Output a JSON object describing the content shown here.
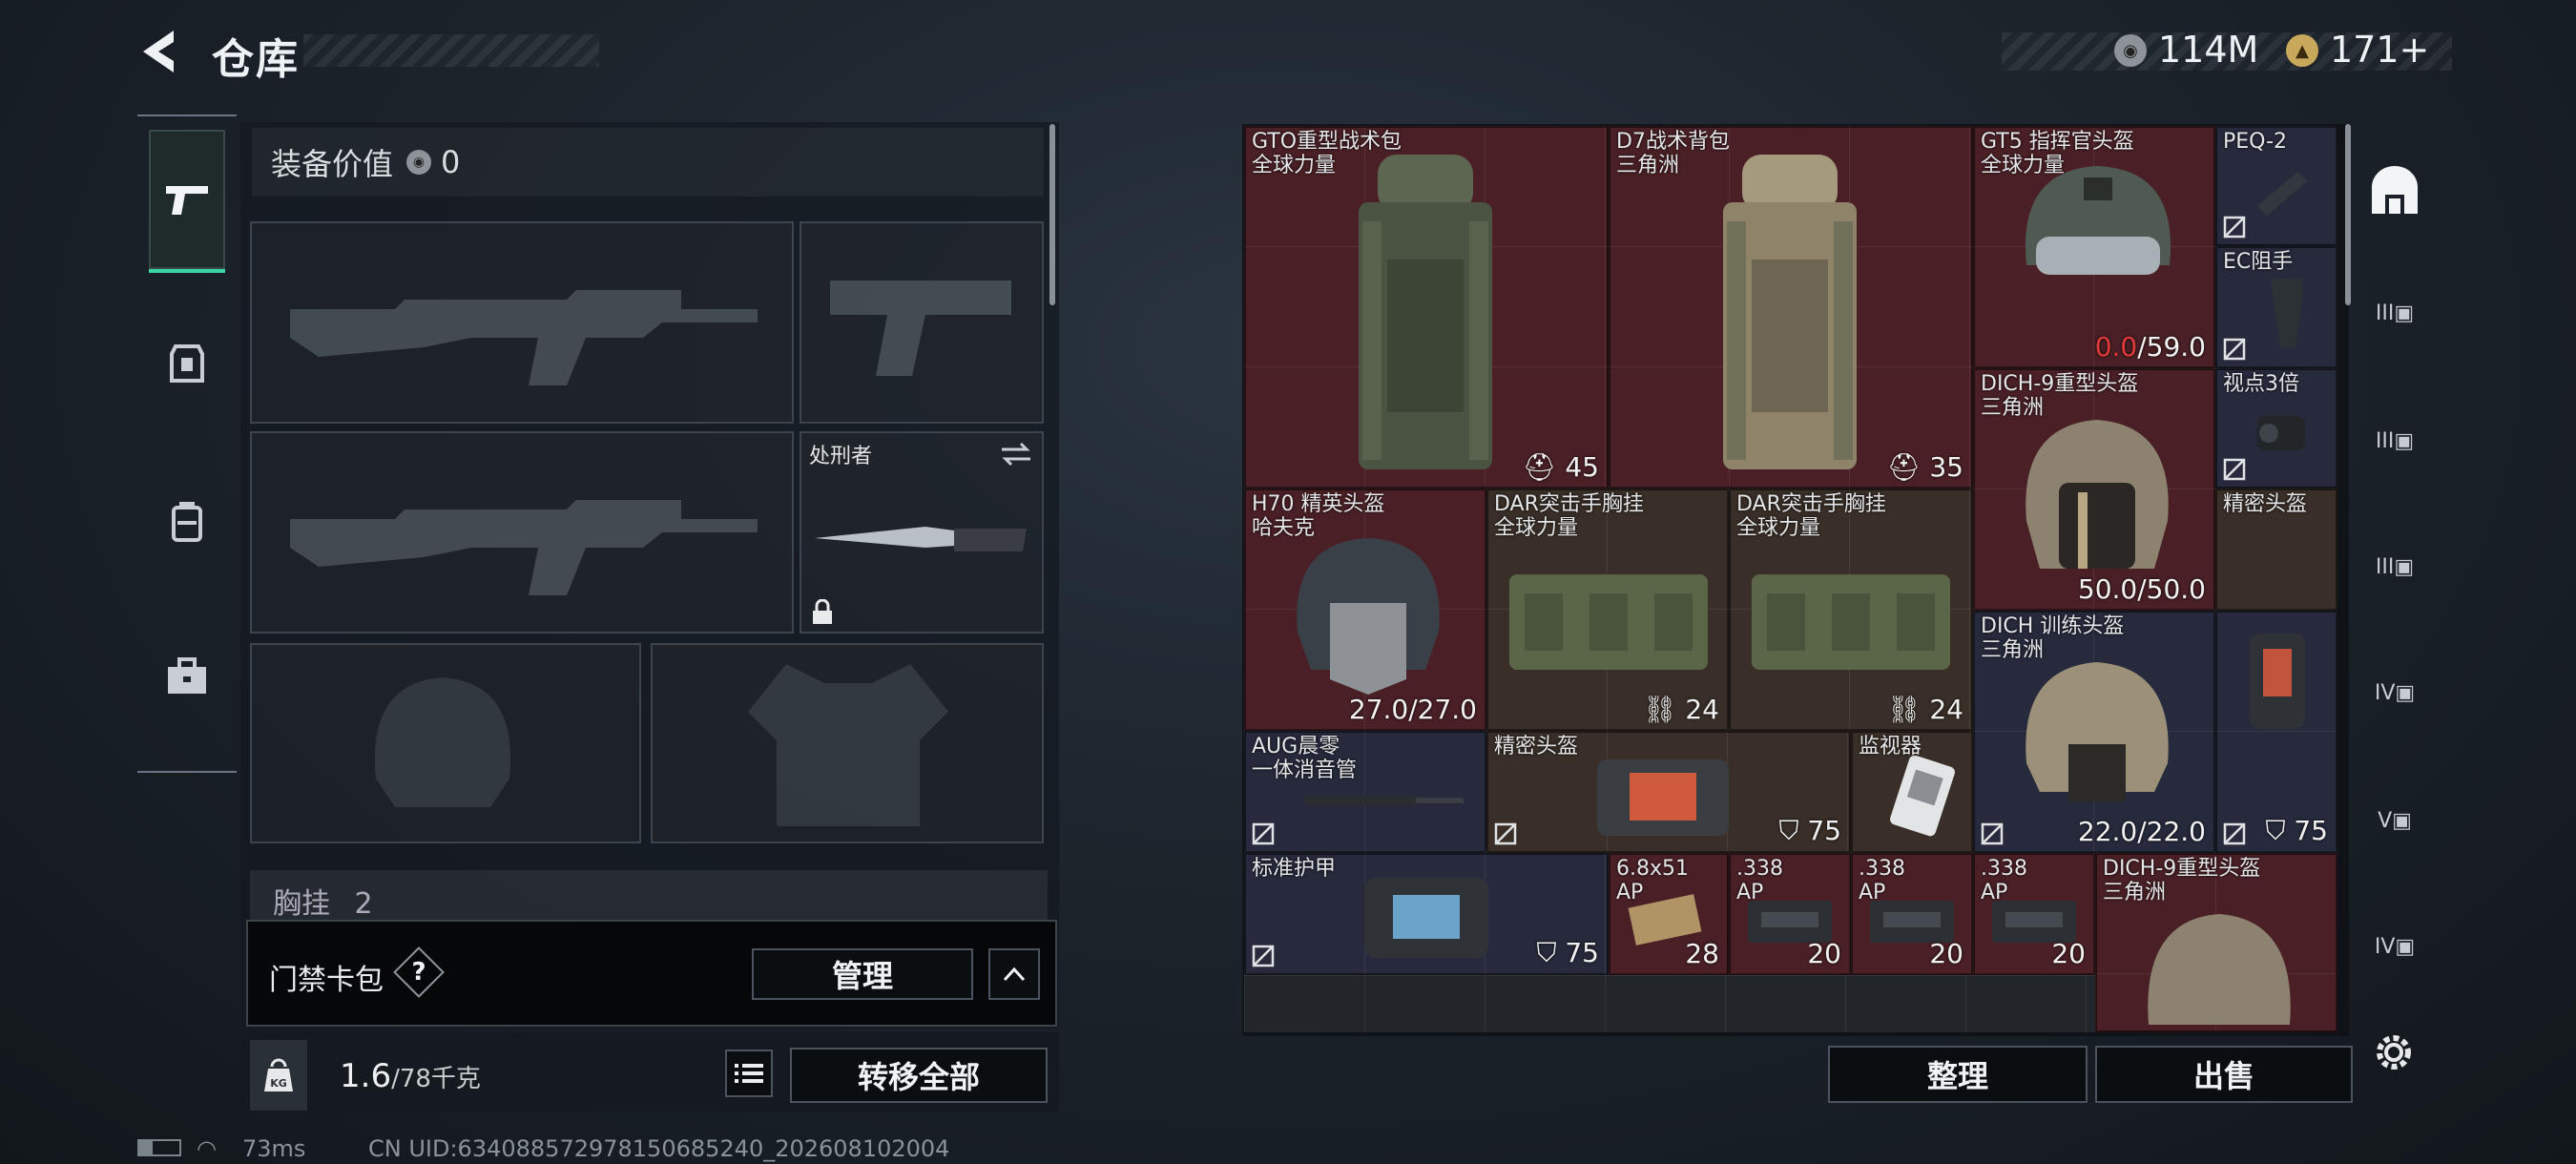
{
  "header": {
    "title": "仓库",
    "currency1": "114M",
    "currency2": "171+"
  },
  "equipment": {
    "value_label": "装备价值",
    "value": "0",
    "melee_name": "处刑者",
    "chest_label": "胸挂",
    "chest_count": "2"
  },
  "keycard": {
    "label": "门禁卡包",
    "help": "?",
    "manage": "管理"
  },
  "capacity": {
    "current": "1.6",
    "max": "/78千克",
    "transfer_all": "转移全部"
  },
  "status": {
    "ping": "73ms",
    "uid": "CN UID:634088572978150685240_202608102004"
  },
  "storage": {
    "items": [
      {
        "name": "GTO重型战术包\n全球力量",
        "value": "45"
      },
      {
        "name": "D7战术背包\n三角洲",
        "value": "35"
      },
      {
        "name": "GT5 指挥官头盔\n全球力量",
        "value_red": "0.0",
        "value": "/59.0"
      },
      {
        "name": "PEQ-2"
      },
      {
        "name": "EC阻手"
      },
      {
        "name": "视点3倍"
      },
      {
        "name": "精密头盔"
      },
      {
        "name": "DICH-9重型头盔\n三角洲",
        "value": "50.0/50.0"
      },
      {
        "name": "H70 精英头盔\n哈夫克",
        "value": "27.0/27.0"
      },
      {
        "name": "DAR突击手胸挂\n全球力量",
        "value": "24"
      },
      {
        "name": "DAR突击手胸挂\n全球力量",
        "value": "24"
      },
      {
        "name": "DICH 训练头盔\n三角洲",
        "value": "22.0/22.0"
      },
      {
        "name": "",
        "value": "75"
      },
      {
        "name": "AUG晨零\n一体消音管"
      },
      {
        "name": "精密头盔",
        "value": "75"
      },
      {
        "name": "监视器"
      },
      {
        "name": "标准护甲",
        "value": "75"
      },
      {
        "name": "6.8x51\nAP",
        "value": "28"
      },
      {
        "name": ".338\nAP",
        "value": "20"
      },
      {
        "name": ".338\nAP",
        "value": "20"
      },
      {
        "name": "DICH-9重型头盔\n三角洲"
      }
    ],
    "sort_button": "整理",
    "sell_button": "出售"
  },
  "side_tabs": {
    "t1": "III",
    "t2": "III",
    "t3": "III",
    "t4": "IV",
    "t5": "V",
    "t6": "IV"
  }
}
